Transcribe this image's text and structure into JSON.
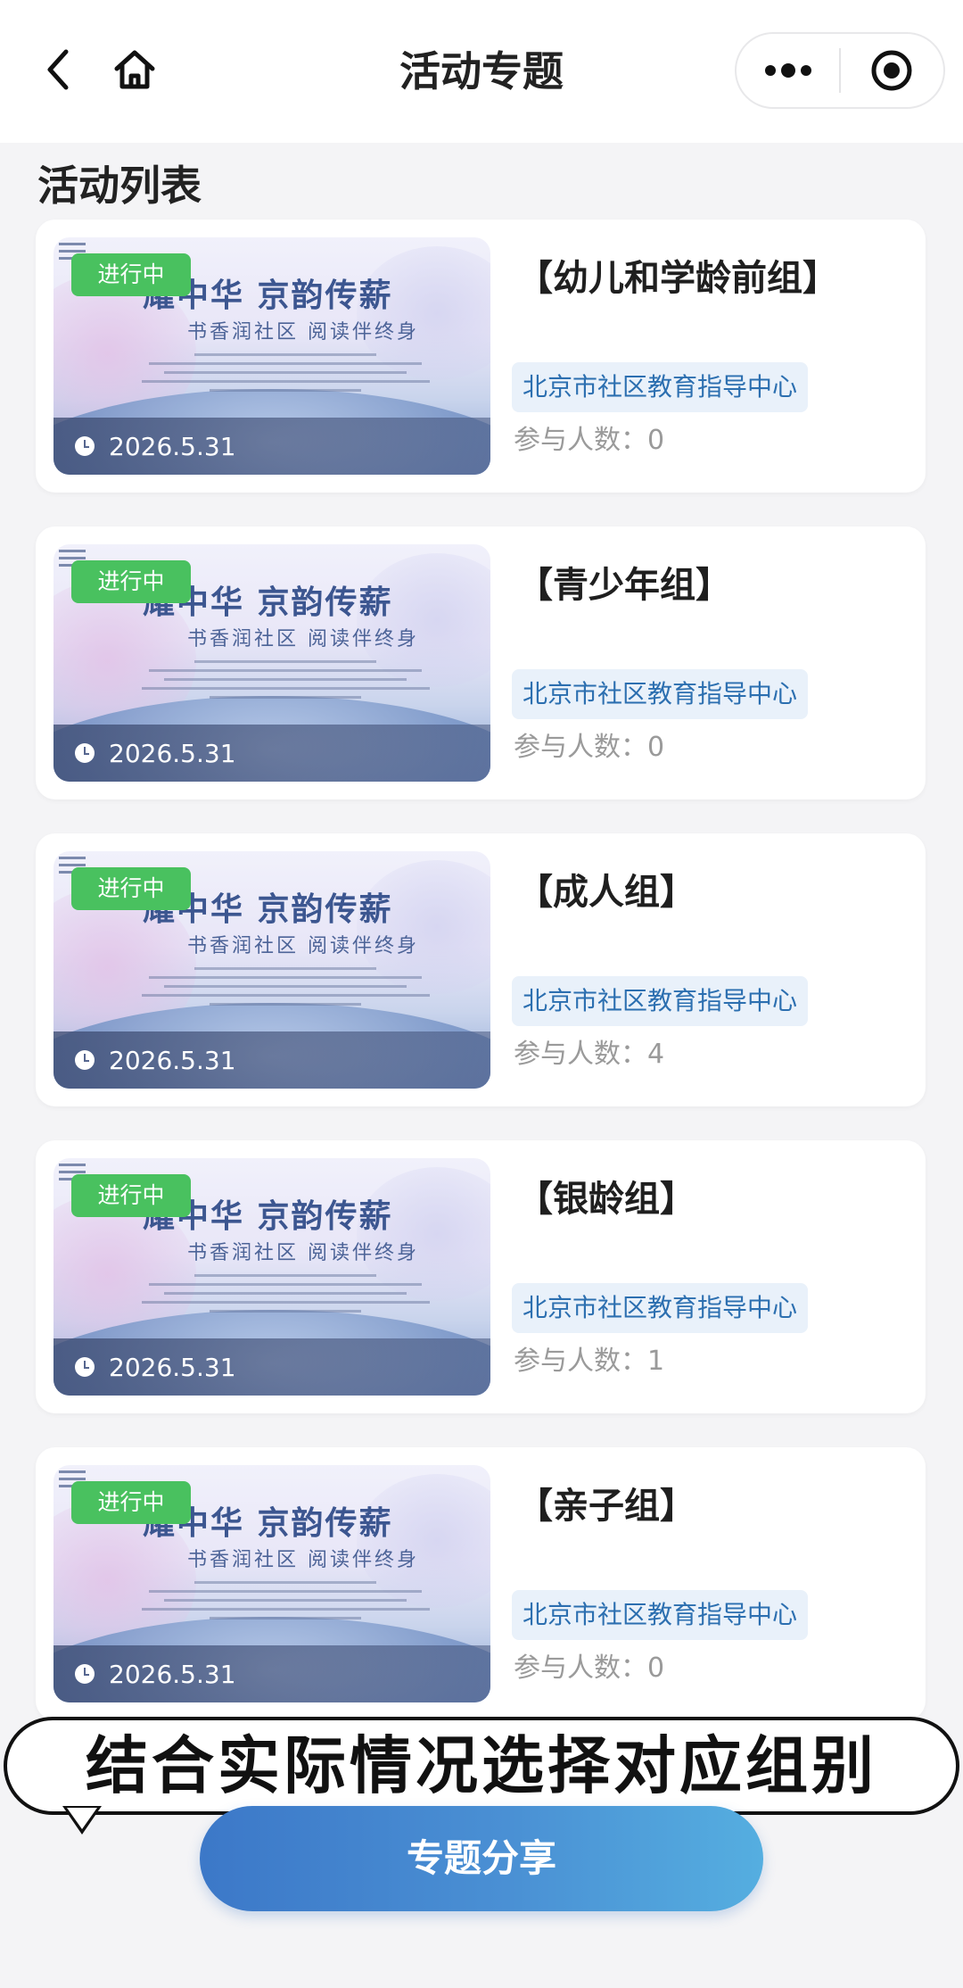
{
  "nav": {
    "title": "活动专题",
    "back_icon": "back-icon",
    "home_icon": "home-icon",
    "more_icon": "more-icon",
    "close_icon": "target-icon"
  },
  "section_title": "活动列表",
  "cards": [
    {
      "status": "进行中",
      "date": "2026.5.31",
      "title": "【幼儿和学龄前组】",
      "org": "北京市社区教育指导中心",
      "participants": "参与人数：0"
    },
    {
      "status": "进行中",
      "date": "2026.5.31",
      "title": "【青少年组】",
      "org": "北京市社区教育指导中心",
      "participants": "参与人数：0"
    },
    {
      "status": "进行中",
      "date": "2026.5.31",
      "title": "【成人组】",
      "org": "北京市社区教育指导中心",
      "participants": "参与人数：4"
    },
    {
      "status": "进行中",
      "date": "2026.5.31",
      "title": "【银龄组】",
      "org": "北京市社区教育指导中心",
      "participants": "参与人数：1"
    },
    {
      "status": "进行中",
      "date": "2026.5.31",
      "title": "【亲子组】",
      "org": "北京市社区教育指导中心",
      "participants": "参与人数：0"
    }
  ],
  "thumbnail": {
    "headline": "耀中华 京韵传薪",
    "subline": "书香润社区 阅读伴终身"
  },
  "caption": "结合实际情况选择对应组别",
  "share_button": "专题分享",
  "colors": {
    "status_badge": "#49c15f",
    "org_tag_bg": "#e9f1fa",
    "org_tag_text": "#2c6fb0",
    "button_gradient_start": "#3c78c8",
    "button_gradient_end": "#55aee0"
  }
}
